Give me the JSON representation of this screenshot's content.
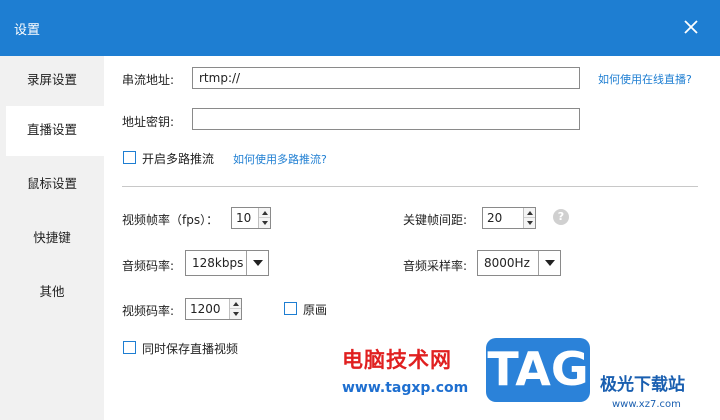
{
  "window": {
    "title": "设置",
    "close_icon": "close-icon"
  },
  "sidebar": {
    "items": [
      {
        "label": "录屏设置",
        "active": false
      },
      {
        "label": "直播设置",
        "active": true
      },
      {
        "label": "鼠标设置",
        "active": false
      },
      {
        "label": "快捷键",
        "active": false
      },
      {
        "label": "其他",
        "active": false
      }
    ]
  },
  "stream": {
    "url_label": "串流地址:",
    "url_value": "rtmp://",
    "url_help_link": "如何使用在线直播?",
    "key_label": "地址密钥:",
    "key_value": "",
    "multi_label": "开启多路推流",
    "multi_checked": false,
    "multi_help_link": "如何使用多路推流?"
  },
  "video": {
    "fps_label": "视频帧率（fps）：",
    "fps_value": "10",
    "keyframe_label": "关键帧间距:",
    "keyframe_value": "20",
    "help_icon": "question-icon",
    "audio_bitrate_label": "音频码率:",
    "audio_bitrate_value": "128kbps",
    "sample_rate_label": "音频采样率:",
    "sample_rate_value": "8000Hz",
    "video_bitrate_label": "视频码率:",
    "video_bitrate_value": "1200",
    "original_label": "原画",
    "original_checked": false,
    "save_label": "同时保存直播视频",
    "save_checked": false
  },
  "watermark": {
    "site_name": "电脑技术网",
    "site_url": "www.tagxp.com",
    "logo_text": "TAG",
    "brand_name": "极光下载站",
    "brand_url": "www.xz7.com"
  },
  "colors": {
    "accent": "#1e7ed2",
    "sidebar_bg": "#f1f1f1"
  }
}
